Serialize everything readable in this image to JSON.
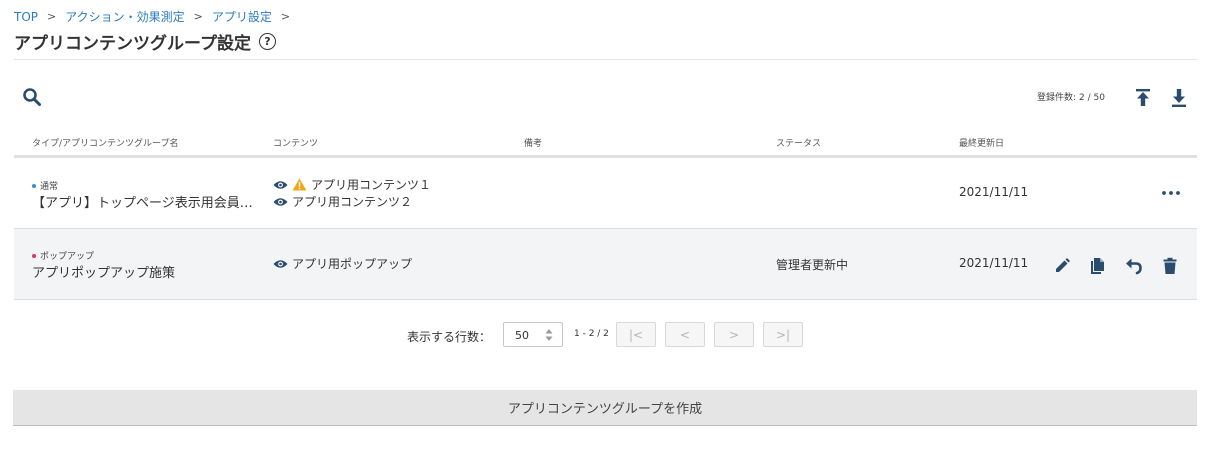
{
  "breadcrumb": {
    "items": [
      "TOP",
      "アクション・効果測定",
      "アプリ設定"
    ],
    "separator": ">"
  },
  "page": {
    "title": "アプリコンテンツグループ設定",
    "help_glyph": "?"
  },
  "toolbar": {
    "count_label": "登録件数:",
    "count_value": "2 / 50"
  },
  "table": {
    "columns": [
      "タイプ/アプリコンテンツグループ名",
      "コンテンツ",
      "備考",
      "ステータス",
      "最終更新日"
    ],
    "rows": [
      {
        "type": "通常",
        "type_color": "#3a8fd6",
        "name": "【アプリ】トップページ表示用会員向けコンテンツ",
        "contents": [
          "アプリ用コンテンツ１",
          "アプリ用コンテンツ２"
        ],
        "note": "",
        "status": "",
        "date": "2021/11/11"
      },
      {
        "type": "ポップアップ",
        "type_color": "#e0325f",
        "name": "アプリポップアップ施策",
        "contents": [
          "アプリ用ポップアップ"
        ],
        "note": "",
        "status": "管理者更新中",
        "date": "2021/11/11"
      }
    ]
  },
  "pagination": {
    "rows_label": "表示する行数：",
    "rows_value": "50",
    "range": "1 - 2 / 2",
    "first": "|<",
    "prev": "<",
    "next": ">",
    "last": ">|"
  },
  "actions": {
    "create_label": "アプリコンテンツグループを作成"
  },
  "colors": {
    "link": "#2b7cc0",
    "icon": "#2a4d6e",
    "warning": "#f0a818"
  }
}
